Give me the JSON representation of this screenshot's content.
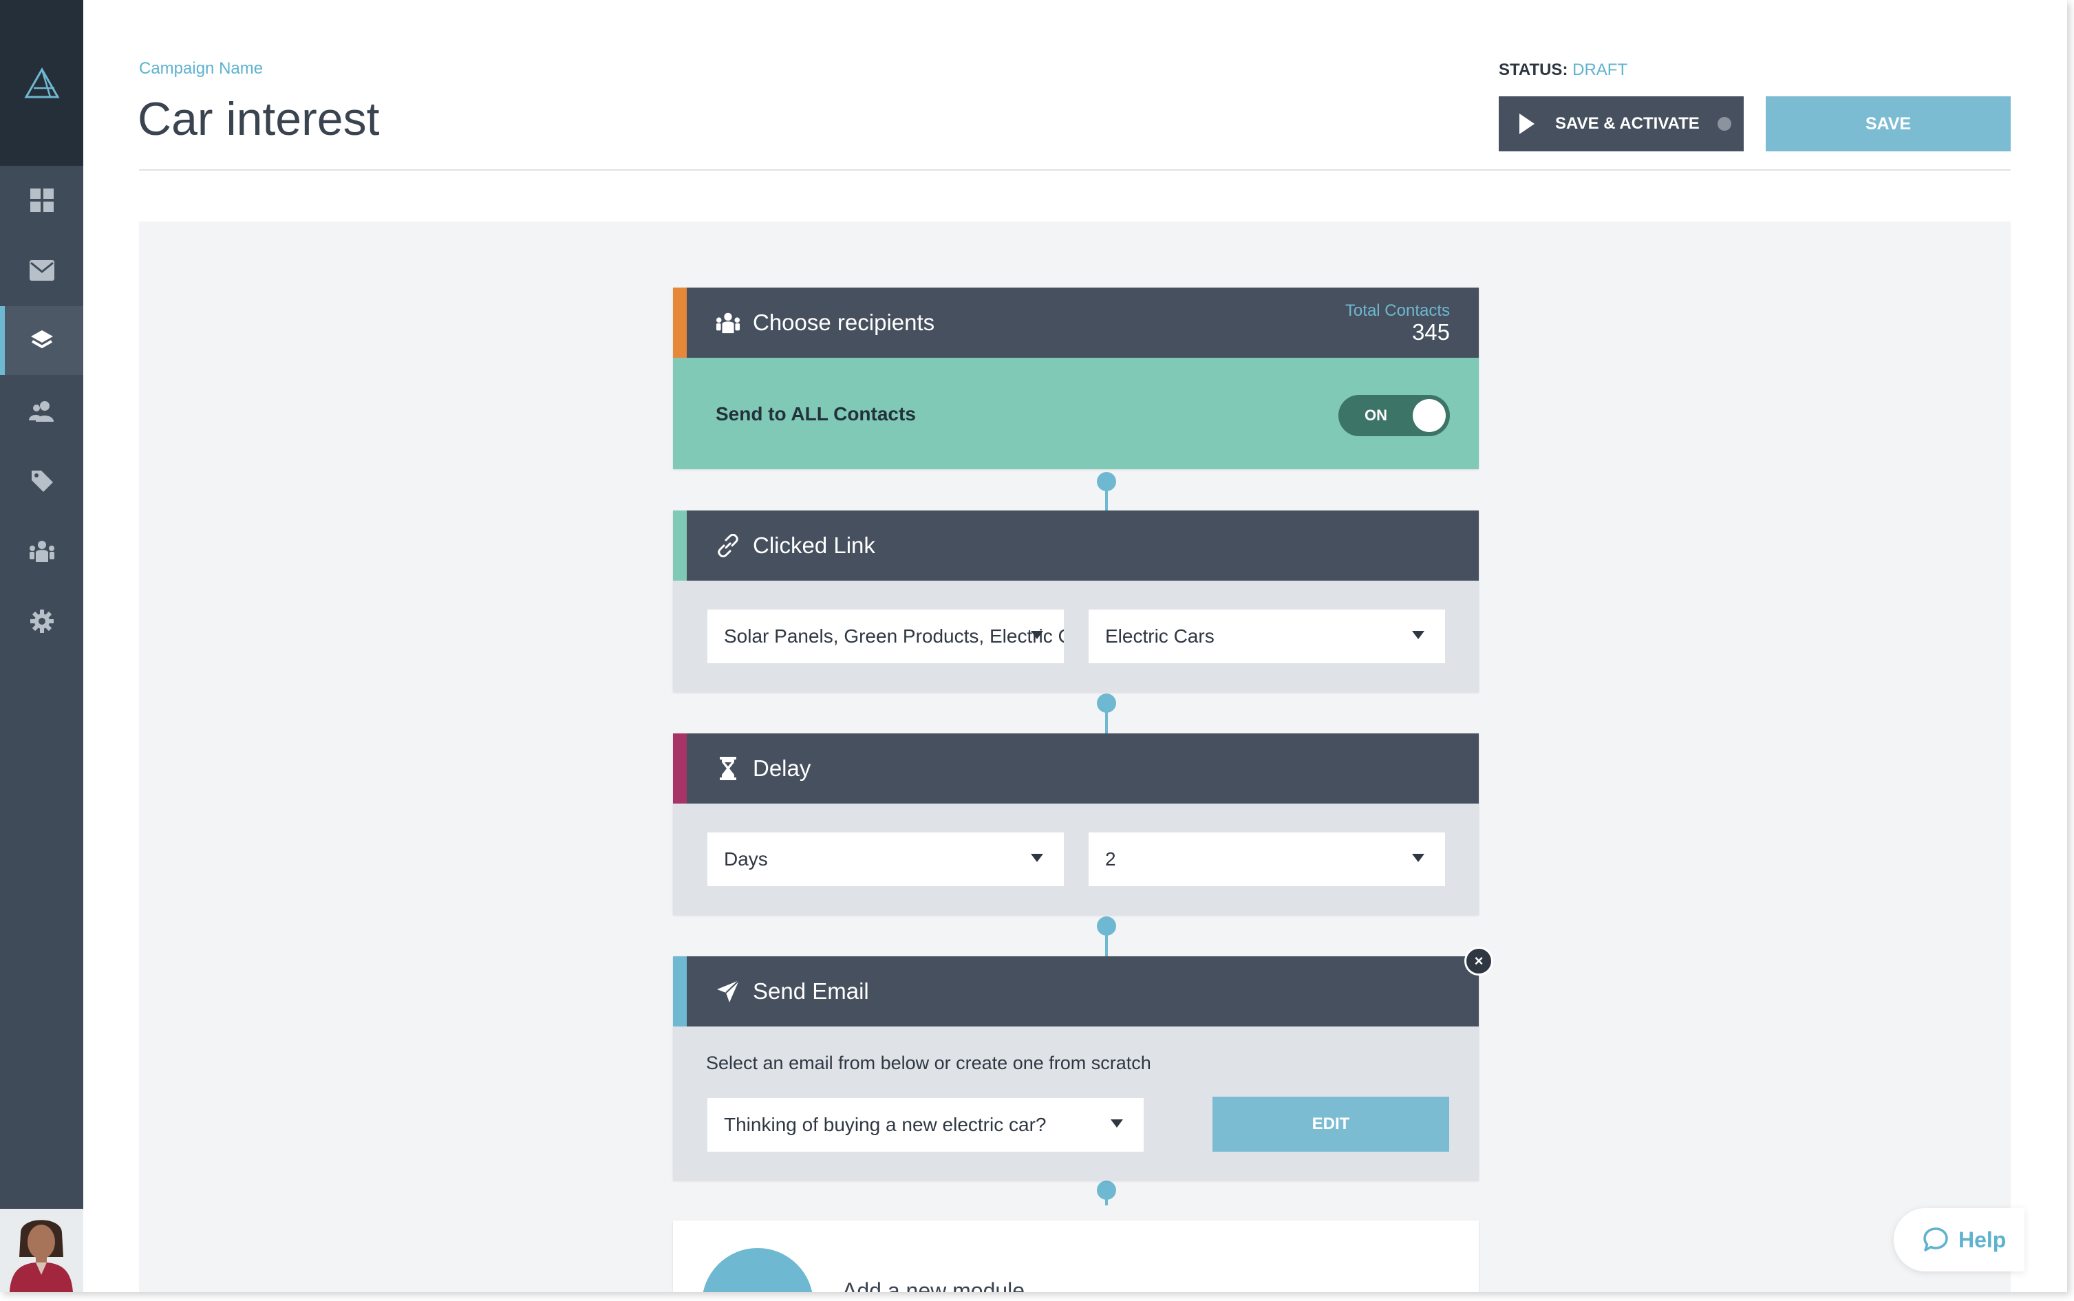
{
  "header": {
    "campaign_label": "Campaign Name",
    "campaign_name": "Car interest",
    "status_label": "STATUS:",
    "status_value": "DRAFT",
    "save_activate_label": "SAVE & ACTIVATE",
    "save_label": "SAVE"
  },
  "sidebar": {
    "items": [
      {
        "icon": "dashboard-icon"
      },
      {
        "icon": "mail-icon"
      },
      {
        "icon": "layers-icon",
        "active": true
      },
      {
        "icon": "users-icon"
      },
      {
        "icon": "tag-icon"
      },
      {
        "icon": "group-icon"
      },
      {
        "icon": "gear-icon"
      }
    ]
  },
  "modules": {
    "recipients": {
      "title": "Choose recipients",
      "total_label": "Total Contacts",
      "total_value": "345",
      "send_all_label": "Send to ALL Contacts",
      "toggle_label": "ON",
      "accent": "#e6883a"
    },
    "clicked_link": {
      "title": "Clicked Link",
      "select_1": "Solar Panels, Green Products, Electric Cars",
      "select_2": "Electric Cars",
      "accent": "#7fc9b6"
    },
    "delay": {
      "title": "Delay",
      "unit": "Days",
      "amount": "2",
      "accent": "#a63467"
    },
    "send_email": {
      "title": "Send Email",
      "instruction": "Select an email from below or create one from scratch",
      "email_select": "Thinking of buying a new electric car?",
      "edit_label": "EDIT",
      "close_label": "×",
      "accent": "#6fb8d1"
    },
    "add_module": {
      "label": "Add a new module"
    }
  },
  "help": {
    "label": "Help"
  },
  "colors": {
    "sidebar": "#3f4b59",
    "teal": "#7fc9b6",
    "blue": "#6fb8d1",
    "dark": "#46505e"
  }
}
